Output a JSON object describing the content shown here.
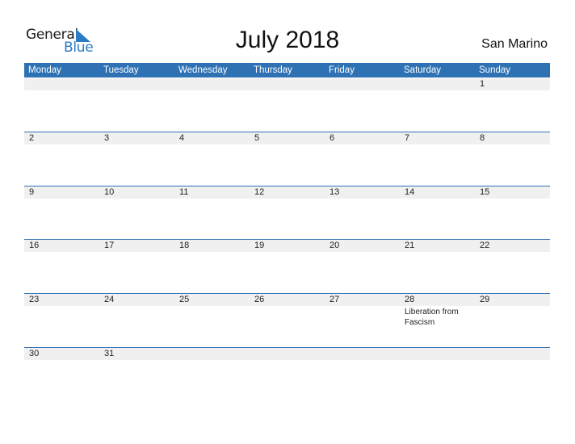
{
  "logo": {
    "line1": "General",
    "line2": "Blue"
  },
  "title": "July 2018",
  "country": "San Marino",
  "weekdays": [
    "Monday",
    "Tuesday",
    "Wednesday",
    "Thursday",
    "Friday",
    "Saturday",
    "Sunday"
  ],
  "weeks": [
    [
      "",
      "",
      "",
      "",
      "",
      "",
      "1"
    ],
    [
      "2",
      "3",
      "4",
      "5",
      "6",
      "7",
      "8"
    ],
    [
      "9",
      "10",
      "11",
      "12",
      "13",
      "14",
      "15"
    ],
    [
      "16",
      "17",
      "18",
      "19",
      "20",
      "21",
      "22"
    ],
    [
      "23",
      "24",
      "25",
      "26",
      "27",
      "28",
      "29"
    ],
    [
      "30",
      "31",
      "",
      "",
      "",
      "",
      ""
    ]
  ],
  "events": [
    {
      "week": 4,
      "day": 5,
      "label": "Liberation from Fascism"
    }
  ],
  "colors": {
    "header": "#2e72b4",
    "band": "#f0f0f0",
    "brand_blue": "#2a7bc4"
  }
}
